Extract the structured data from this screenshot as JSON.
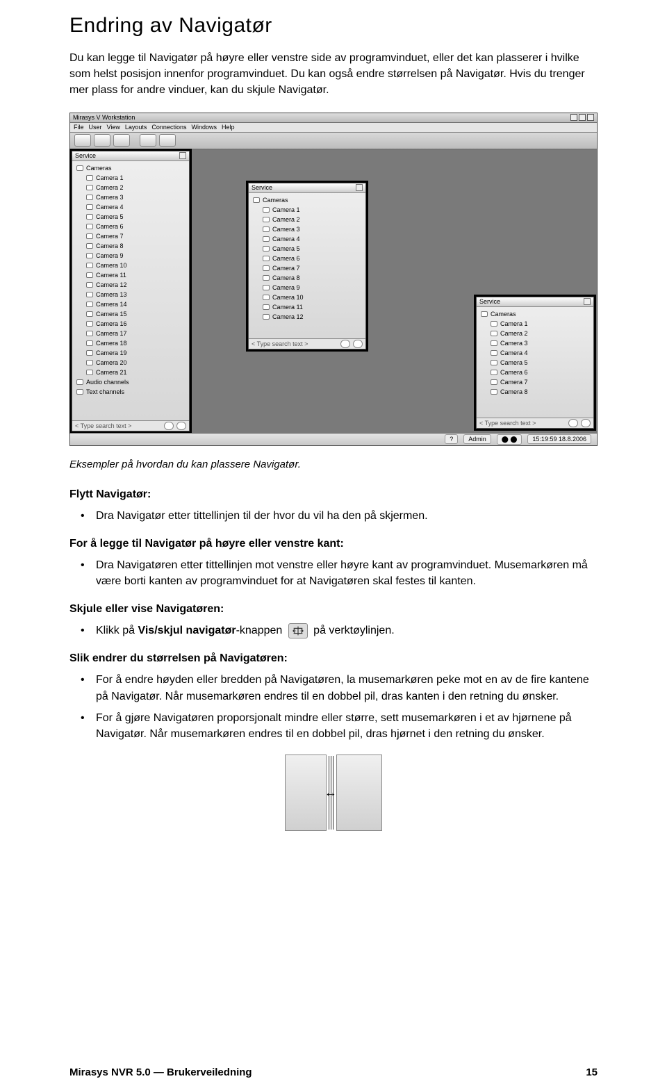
{
  "heading": "Endring av Navigatør",
  "intro": "Du kan legge til Navigatør på høyre eller venstre side av programvinduet, eller det kan plasserer i hvilke som helst posisjon innenfor programvinduet. Du kan også endre størrelsen på Navigatør. Hvis du trenger mer plass for andre vinduer, kan du skjule Navigatør.",
  "caption": "Eksempler på hvordan du kan plassere Navigatør.",
  "sections": {
    "flytt": {
      "title": "Flytt Navigatør:",
      "li1": "Dra Navigatør etter tittellinjen til der hvor du vil ha den på skjermen."
    },
    "legge": {
      "title": "For å legge til Navigatør på høyre eller venstre kant:",
      "li1": "Dra Navigatøren etter tittellinjen mot venstre eller høyre kant av programvinduet. Musemarkøren må være borti kanten av programvinduet for at Navigatøren skal festes til kanten."
    },
    "skjule": {
      "title": "Skjule eller vise Navigatøren:",
      "li1_a": "Klikk på ",
      "li1_b": "Vis/skjul navigatør",
      "li1_c": "-knappen ",
      "li1_d": " på verktøylinjen."
    },
    "endre": {
      "title": "Slik endrer du størrelsen på Navigatøren:",
      "li1": "For å endre høyden eller bredden på Navigatøren, la musemarkøren peke mot en av de fire kantene på Navigatør. Når musemarkøren endres til en dobbel pil, dras kanten i den retning du ønsker.",
      "li2": "For å gjøre Navigatøren proporsjonalt mindre eller større, sett musemarkøren i et av hjørnene på Navigatør. Når musemarkøren endres til en dobbel pil, dras hjørnet i den retning du ønsker."
    }
  },
  "mock": {
    "title": "Mirasys V Workstation",
    "menus": [
      "File",
      "User",
      "View",
      "Layouts",
      "Connections",
      "Windows",
      "Help"
    ],
    "status_admin": "Admin",
    "status_time": "15:19:59 18.8.2006",
    "panel_title": "Service",
    "root_node": "Cameras",
    "search_placeholder": "< Type search text >",
    "audio_label": "Audio channels",
    "text_label": "Text channels",
    "left_items": [
      "Camera 1",
      "Camera 2",
      "Camera 3",
      "Camera 4",
      "Camera 5",
      "Camera 6",
      "Camera 7",
      "Camera 8",
      "Camera 9",
      "Camera 10",
      "Camera 11",
      "Camera 12",
      "Camera 13",
      "Camera 14",
      "Camera 15",
      "Camera 16",
      "Camera 17",
      "Camera 18",
      "Camera 19",
      "Camera 20",
      "Camera 21"
    ],
    "mid_items": [
      "Camera 1",
      "Camera 2",
      "Camera 3",
      "Camera 4",
      "Camera 5",
      "Camera 6",
      "Camera 7",
      "Camera 8",
      "Camera 9",
      "Camera 10",
      "Camera 11",
      "Camera 12"
    ],
    "right_items": [
      "Camera 1",
      "Camera 2",
      "Camera 3",
      "Camera 4",
      "Camera 5",
      "Camera 6",
      "Camera 7",
      "Camera 8"
    ]
  },
  "footer": {
    "left": "Mirasys NVR 5.0 — Brukerveiledning",
    "right": "15"
  }
}
